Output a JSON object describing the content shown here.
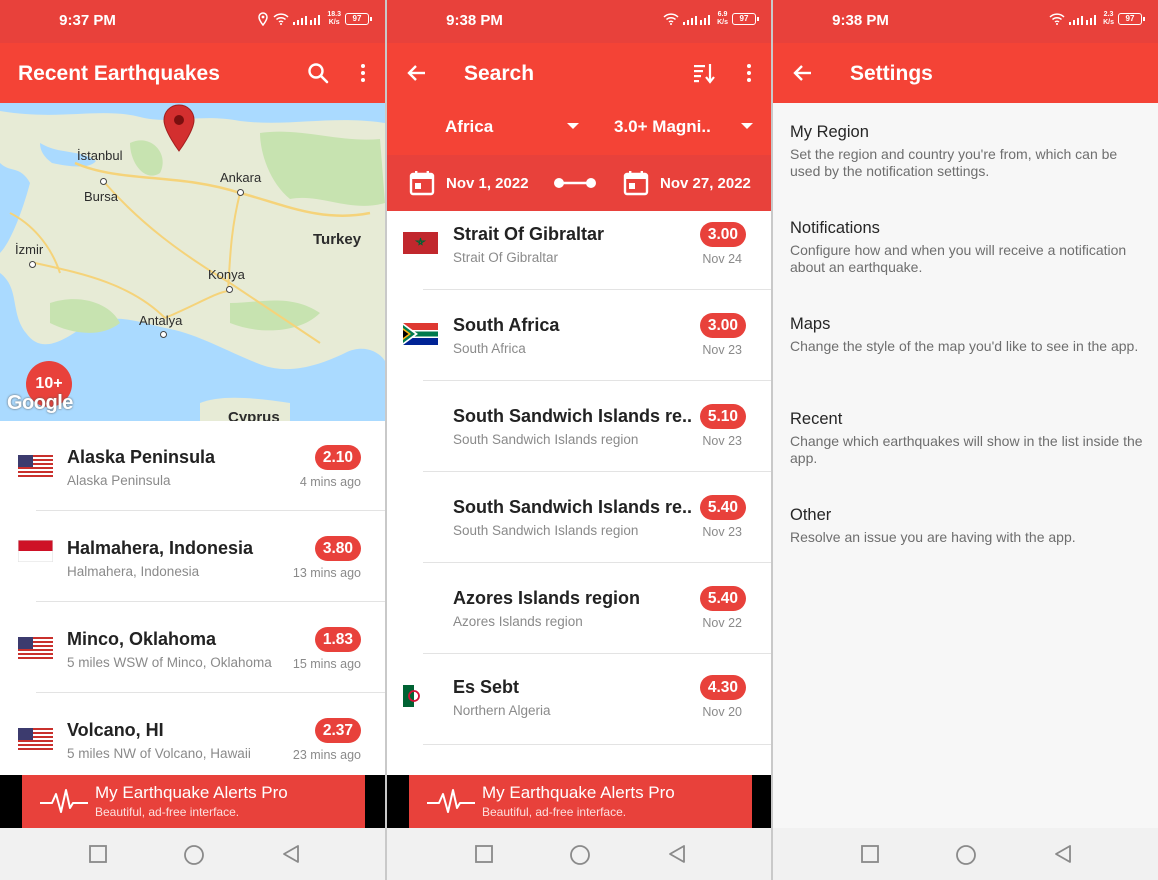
{
  "colors": {
    "primary": "#f44336",
    "primary_dark": "#e8413b",
    "badge": "#e8413b"
  },
  "screen1": {
    "status": {
      "time": "9:37 PM",
      "net_speed_top": "18.3",
      "net_speed_unit": "K/s",
      "battery": "97"
    },
    "title": "Recent Earthquakes",
    "icons": [
      "search-icon",
      "more-vert-icon"
    ],
    "map": {
      "cluster_label": "10+",
      "google": "Google",
      "labels": {
        "istanbul": "İstanbul",
        "bursa": "Bursa",
        "ankara": "Ankara",
        "izmir": "İzmir",
        "turkey": "Turkey",
        "konya": "Konya",
        "antalya": "Antalya",
        "cyprus": "Cyprus"
      }
    },
    "quakes": [
      {
        "title": "Alaska Peninsula",
        "subtitle": "Alaska Peninsula",
        "magnitude": "2.10",
        "time": "4 mins ago",
        "flag": "us"
      },
      {
        "title": "Halmahera, Indonesia",
        "subtitle": "Halmahera, Indonesia",
        "magnitude": "3.80",
        "time": "13 mins ago",
        "flag": "id"
      },
      {
        "title": "Minco, Oklahoma",
        "subtitle": "5 miles WSW of Minco, Oklahoma",
        "magnitude": "1.83",
        "time": "15 mins ago",
        "flag": "us"
      },
      {
        "title": "Volcano, HI",
        "subtitle": "5 miles NW of Volcano, Hawaii",
        "magnitude": "2.37",
        "time": "23 mins ago",
        "flag": "us"
      }
    ],
    "banner": {
      "title": "My Earthquake Alerts Pro",
      "subtitle": "Beautiful, ad-free interface."
    }
  },
  "screen2": {
    "status": {
      "time": "9:38 PM",
      "net_speed_top": "6.9",
      "net_speed_unit": "K/s",
      "battery": "97"
    },
    "title": "Search",
    "icons": [
      "back-arrow-icon",
      "sort-icon",
      "more-vert-icon"
    ],
    "filters": {
      "region": "Africa",
      "magnitude": "3.0+ Magni.."
    },
    "dates": {
      "start": "Nov 1, 2022",
      "end": "Nov 27, 2022"
    },
    "quakes": [
      {
        "title": "Strait Of Gibraltar",
        "subtitle": "Strait Of Gibraltar",
        "magnitude": "3.00",
        "time": "Nov 24",
        "flag": "ma"
      },
      {
        "title": "South Africa",
        "subtitle": "South Africa",
        "magnitude": "3.00",
        "time": "Nov 23",
        "flag": "za"
      },
      {
        "title": "South Sandwich Islands re...",
        "subtitle": "South Sandwich Islands region",
        "magnitude": "5.10",
        "time": "Nov 23",
        "flag": ""
      },
      {
        "title": "South Sandwich Islands re...",
        "subtitle": "South Sandwich Islands region",
        "magnitude": "5.40",
        "time": "Nov 23",
        "flag": ""
      },
      {
        "title": "Azores Islands region",
        "subtitle": "Azores Islands region",
        "magnitude": "5.40",
        "time": "Nov 22",
        "flag": ""
      },
      {
        "title": "Es Sebt",
        "subtitle": "Northern Algeria",
        "magnitude": "4.30",
        "time": "Nov 20",
        "flag": "dz"
      }
    ],
    "banner": {
      "title": "My Earthquake Alerts Pro",
      "subtitle": "Beautiful, ad-free interface."
    }
  },
  "screen3": {
    "status": {
      "time": "9:38 PM",
      "net_speed_top": "2.3",
      "net_speed_unit": "K/s",
      "battery": "97"
    },
    "title": "Settings",
    "settings": [
      {
        "title": "My Region",
        "desc": "Set the region and country you're from, which can be used by the notification settings."
      },
      {
        "title": "Notifications",
        "desc": "Configure how and when you will receive a notification about an earthquake."
      },
      {
        "title": "Maps",
        "desc": "Change the style of the map you'd like to see in the app."
      },
      {
        "title": "Recent",
        "desc": "Change which earthquakes will show in the list inside the app."
      },
      {
        "title": "Other",
        "desc": "Resolve an issue you are having with the app."
      }
    ]
  }
}
